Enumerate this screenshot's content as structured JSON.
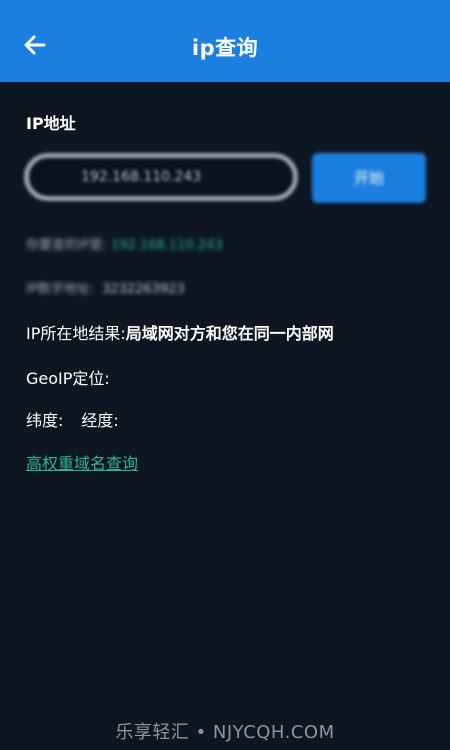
{
  "header": {
    "title": "ip查询",
    "back_icon": "arrow-left-icon"
  },
  "form": {
    "section_label": "IP地址",
    "ip_value": "192.168.110.243",
    "query_button_label": "开始"
  },
  "info": {
    "your_ip_label": "你要查的IP是:",
    "your_ip_value": "192.168.110.243",
    "num_label": "IP数字地址:",
    "num_value": "3232263923"
  },
  "result": {
    "location_label": "IP所在地结果:",
    "location_value": "局域网对方和您在同一内部网",
    "geoip_label": "GeoIP定位:",
    "lat_label": "纬度:",
    "lng_label": "经度:"
  },
  "links": {
    "domain_query": "高权重域名查询"
  },
  "footer": {
    "watermark": "乐享轻汇 • NJYCQH.COM"
  },
  "colors": {
    "appbar": "#1b7fe0",
    "background": "#0d1621",
    "link": "#2fb59a"
  }
}
